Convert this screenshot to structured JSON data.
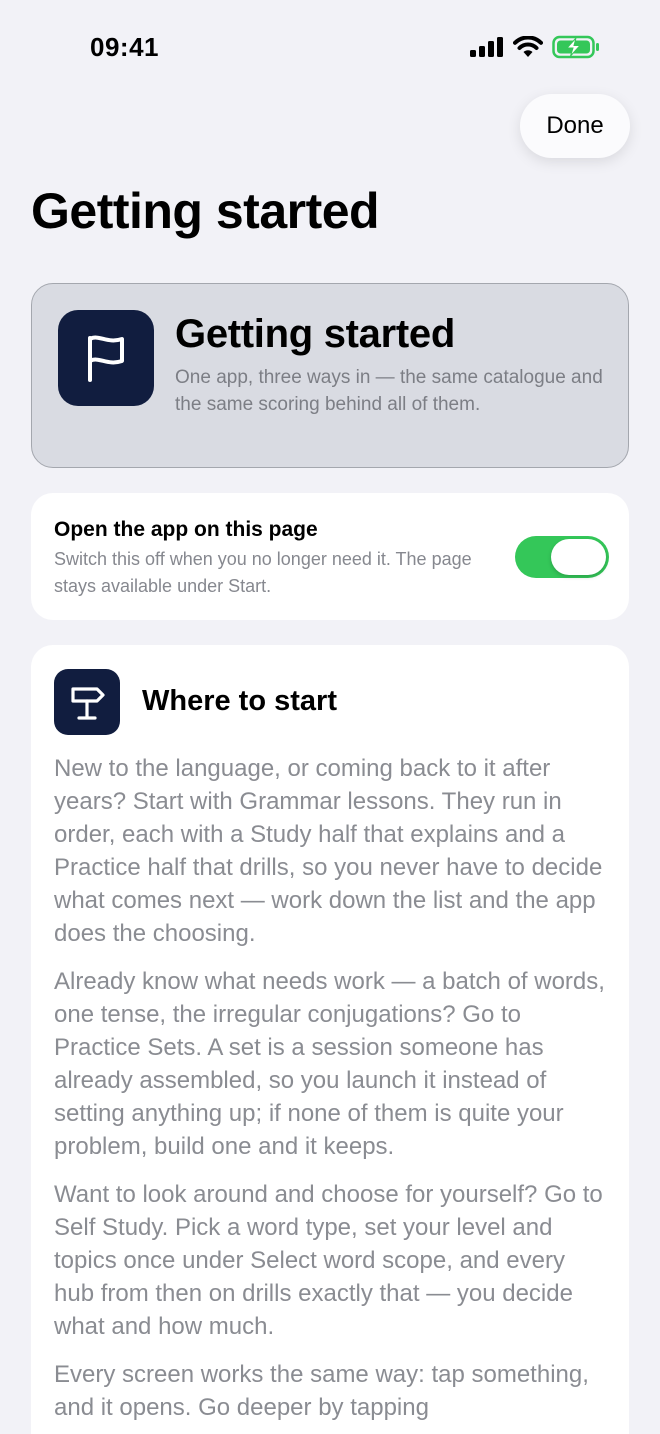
{
  "status_bar": {
    "time": "09:41"
  },
  "header": {
    "done_label": "Done",
    "title": "Getting started"
  },
  "hero": {
    "icon": "flag-icon",
    "title": "Getting started",
    "subtitle": "One app, three ways in — the same catalogue and the same scoring behind all of them."
  },
  "toggle": {
    "title": "Open the app on this page",
    "description": "Switch this off when you no longer need it. The page stays available under Start.",
    "on": true,
    "color": "#34c759"
  },
  "section": {
    "icon": "signpost-icon",
    "heading": "Where to start",
    "paragraphs": [
      "New to the language, or coming back to it after years? Start with Grammar lessons. They run in order, each with a Study half that explains and a Practice half that drills, so you never have to decide what comes next — work down the list and the app does the choosing.",
      "Already know what needs work — a batch of words, one tense, the irregular conjugations? Go to Practice Sets. A set is a session someone has already assembled, so you launch it instead of setting anything up; if none of them is quite your problem, build one and it keeps.",
      "Want to look around and choose for yourself? Go to Self Study. Pick a word type, set your level and topics once under Select word scope, and every hub from then on drills exactly that — you decide what and how much.",
      "Every screen works the same way: tap something, and it opens. Go deeper by tapping"
    ]
  },
  "colors": {
    "background": "#f2f2f7",
    "icon_tile": "#111d3f",
    "hero_card": "#d9dbe2"
  }
}
